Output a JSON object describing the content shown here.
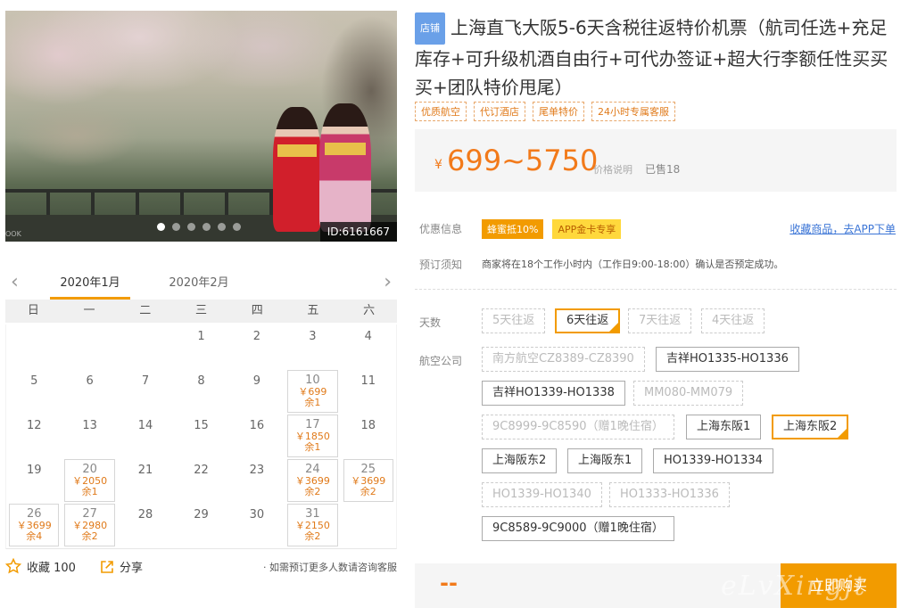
{
  "photo": {
    "id_label": "ID:6161667",
    "logo_text": "OOK",
    "slide_count": 6,
    "active_slide": 0
  },
  "calendar": {
    "prev_label": "‹",
    "next_label": "›",
    "months": [
      "2020年1月",
      "2020年2月"
    ],
    "weekdays": [
      "日",
      "一",
      "二",
      "三",
      "四",
      "五",
      "六"
    ],
    "days": [
      {
        "d": "1",
        "col": 5,
        "row": 1
      },
      {
        "d": "2",
        "col": 6,
        "row": 1
      },
      {
        "d": "3",
        "col": 7,
        "row": 1
      },
      {
        "d": "4",
        "col": 8,
        "row": 1
      }
    ],
    "rows": [
      [
        {
          "d": ""
        },
        {
          "d": ""
        },
        {
          "d": ""
        },
        {
          "d": "1"
        },
        {
          "d": "2"
        },
        {
          "d": "3"
        },
        {
          "d": "4"
        }
      ],
      [
        {
          "d": "5"
        },
        {
          "d": "6"
        },
        {
          "d": "7"
        },
        {
          "d": "8"
        },
        {
          "d": "9"
        },
        {
          "d": "10",
          "p": "￥699",
          "s": "余1"
        },
        {
          "d": "11"
        }
      ],
      [
        {
          "d": "12"
        },
        {
          "d": "13"
        },
        {
          "d": "14"
        },
        {
          "d": "15"
        },
        {
          "d": "16"
        },
        {
          "d": "17",
          "p": "￥1850",
          "s": "余1"
        },
        {
          "d": "18"
        }
      ],
      [
        {
          "d": "19"
        },
        {
          "d": "20",
          "p": "￥2050",
          "s": "余1"
        },
        {
          "d": "21"
        },
        {
          "d": "22"
        },
        {
          "d": "23"
        },
        {
          "d": "24",
          "p": "￥3699",
          "s": "余2"
        },
        {
          "d": "25",
          "p": "￥3699",
          "s": "余2"
        }
      ],
      [
        {
          "d": "26",
          "p": "￥3699",
          "s": "余4"
        },
        {
          "d": "27",
          "p": "￥2980",
          "s": "余2"
        },
        {
          "d": "28"
        },
        {
          "d": "29"
        },
        {
          "d": "30"
        },
        {
          "d": "31",
          "p": "￥2150",
          "s": "余2"
        },
        {
          "d": ""
        }
      ]
    ]
  },
  "footer": {
    "fav_label": "收藏 100",
    "share_label": "分享",
    "note": "· 如需预订更多人数请咨询客服"
  },
  "product": {
    "shop_badge": "店铺",
    "title": "上海直飞大阪5-6天含税往返特价机票（航司任选+充足库存+可升级机酒自由行+可代办签证+超大行李额任性买买买+团队特价甩尾）",
    "tags": [
      "优质航空",
      "代订酒店",
      "尾单特价",
      "24小时专属客服"
    ],
    "price_symbol": "¥",
    "price": "699~5750",
    "price_explain": "价格说明",
    "sold": "已售18"
  },
  "promo": {
    "label": "优惠信息",
    "badge1": "蜂蜜抵10%",
    "badge2": "APP金卡专享",
    "app_link": "收藏商品，去APP下单"
  },
  "booking": {
    "label": "预订须知",
    "text": "商家将在18个工作小时内（工作日9:00-18:00）确认是否预定成功。"
  },
  "days_option": {
    "label": "天数",
    "options": [
      {
        "label": "5天往返",
        "state": "disabled"
      },
      {
        "label": "6天往返",
        "state": "selected"
      },
      {
        "label": "7天往返",
        "state": "disabled"
      },
      {
        "label": "4天往返",
        "state": "disabled"
      }
    ]
  },
  "airline_option": {
    "label": "航空公司",
    "options": [
      {
        "label": "南方航空CZ8389-CZ8390",
        "state": "disabled"
      },
      {
        "label": "吉祥HO1335-HO1336",
        "state": "normal"
      },
      {
        "label": "吉祥HO1339-HO1338",
        "state": "normal"
      },
      {
        "label": "MM080-MM079",
        "state": "disabled"
      },
      {
        "label": "9C8999-9C8590（赠1晚住宿）",
        "state": "disabled"
      },
      {
        "label": "上海东阪1",
        "state": "normal"
      },
      {
        "label": "上海东阪2",
        "state": "selected"
      },
      {
        "label": "上海阪东2",
        "state": "normal"
      },
      {
        "label": "上海阪东1",
        "state": "normal"
      },
      {
        "label": "HO1339-HO1334",
        "state": "normal"
      },
      {
        "label": "HO1339-HO1340",
        "state": "disabled"
      },
      {
        "label": "HO1333-HO1336",
        "state": "disabled"
      },
      {
        "label": "9C8589-9C9000（赠1晚住宿）",
        "state": "normal"
      }
    ]
  },
  "buy": {
    "price_placeholder": "--",
    "button": "立即购买"
  },
  "watermark": "eLvXingjt",
  "colors": {
    "accent": "#f29b00",
    "price": "#f27a1a",
    "link": "#3a74d6",
    "shop_badge": "#6aa0e8"
  }
}
